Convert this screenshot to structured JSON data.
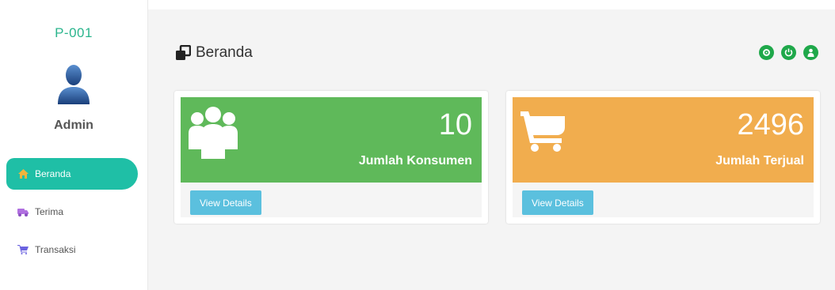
{
  "sidebar": {
    "user_code": "P-001",
    "user_name": "Admin",
    "items": [
      {
        "label": "Beranda",
        "icon": "home-icon",
        "active": true
      },
      {
        "label": "Terima",
        "icon": "truck-icon",
        "active": false
      },
      {
        "label": "Transaksi",
        "icon": "cart-icon",
        "active": false
      }
    ]
  },
  "header": {
    "title": "Beranda",
    "title_icon": "clone-icon",
    "actions": [
      {
        "icon": "gear-icon"
      },
      {
        "icon": "power-icon"
      },
      {
        "icon": "user-icon"
      }
    ]
  },
  "cards": [
    {
      "value": "10",
      "label": "Jumlah Konsumen",
      "icon": "users-icon",
      "button": "View Details",
      "color": "#5fb95a"
    },
    {
      "value": "2496",
      "label": "Jumlah Terjual",
      "icon": "cart-icon",
      "button": "View Details",
      "color": "#f1ad4e"
    }
  ],
  "colors": {
    "accent": "#1fbfa6",
    "action_green": "#1fa84a",
    "info": "#5bc0de"
  }
}
